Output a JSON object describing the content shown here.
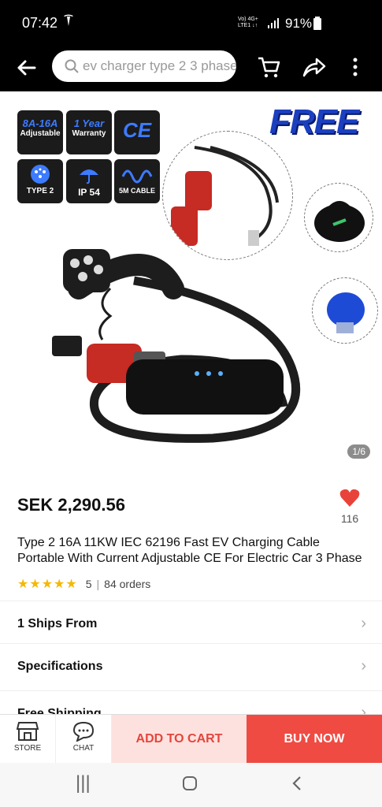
{
  "status": {
    "time": "07:42",
    "network_top": "Vo) 4G+",
    "network_bottom": "LTE1 ↓↑",
    "battery": "91%"
  },
  "search": {
    "placeholder": "ev charger type 2 3 phase"
  },
  "badges": [
    {
      "line1": "8A-16A",
      "line2": "Adjustable"
    },
    {
      "line1": "1 Year",
      "line2": "Warranty"
    },
    {
      "line1": "CE",
      "line2": ""
    },
    {
      "line1": "",
      "line2": "TYPE 2"
    },
    {
      "line1": "",
      "line2": "IP 54"
    },
    {
      "line1": "",
      "line2": "5M CABLE"
    }
  ],
  "gallery": {
    "free_label": "FREE",
    "counter": "1/6"
  },
  "product": {
    "price": "SEK 2,290.56",
    "wishlist_count": "116",
    "title": "Type 2 16A 11KW  IEC 62196 Fast EV Charging Cable Portable With Current Adjustable CE For Electric Car 3 Phase",
    "rating": "5",
    "orders": "84 orders"
  },
  "rows": [
    "1 Ships From",
    "Specifications",
    "Free Shipping"
  ],
  "bottom": {
    "store": "STORE",
    "chat": "CHAT",
    "add_to_cart": "ADD TO CART",
    "buy_now": "BUY NOW"
  },
  "colors": {
    "accent": "#ef4b43",
    "accent_light": "#fde1df",
    "star": "#f5b800"
  }
}
